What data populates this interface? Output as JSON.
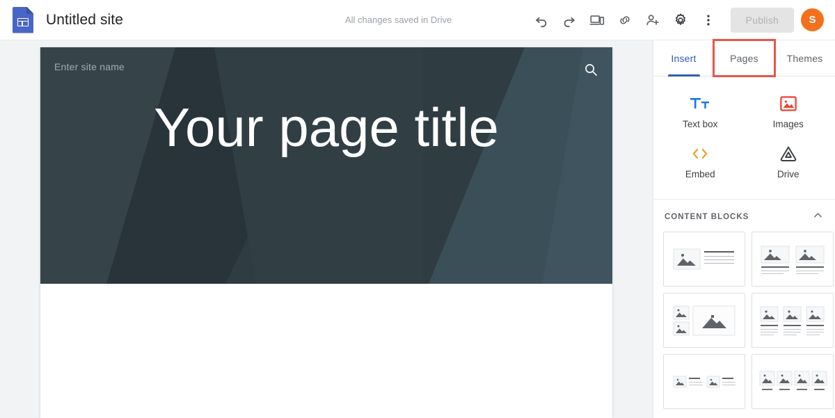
{
  "topbar": {
    "logo_icon": "google-sites-logo",
    "site_title": "Untitled site",
    "save_status": "All changes saved in Drive",
    "actions": [
      {
        "name": "undo",
        "icon": "undo-icon"
      },
      {
        "name": "redo",
        "icon": "redo-icon"
      },
      {
        "name": "preview",
        "icon": "device-preview-icon"
      },
      {
        "name": "copy-link",
        "icon": "link-icon"
      },
      {
        "name": "share",
        "icon": "add-person-icon"
      },
      {
        "name": "settings",
        "icon": "gear-icon"
      },
      {
        "name": "more",
        "icon": "more-vert-icon"
      }
    ],
    "publish_label": "Publish",
    "publish_disabled": true,
    "avatar_initial": "S",
    "avatar_color": "#f4701d"
  },
  "canvas": {
    "site_name_placeholder": "Enter site name",
    "page_title": "Your page title",
    "search_icon": "search-icon",
    "banner_color": "#2f3c42",
    "banner_accent_color": "#3b4f58"
  },
  "panel": {
    "tabs": [
      {
        "label": "Insert",
        "active": true,
        "highlighted": false
      },
      {
        "label": "Pages",
        "active": false,
        "highlighted": true
      },
      {
        "label": "Themes",
        "active": false,
        "highlighted": false
      }
    ],
    "highlight_color": "#e8554a",
    "active_color": "#2f5bb7",
    "insert_items": [
      {
        "label": "Text box",
        "icon": "text-box-icon",
        "color": "#1a73e8"
      },
      {
        "label": "Images",
        "icon": "image-icon",
        "color": "#ea4335"
      },
      {
        "label": "Embed",
        "icon": "embed-code-icon",
        "color": "#f0a020"
      },
      {
        "label": "Drive",
        "icon": "google-drive-icon",
        "color": "#3c4043"
      }
    ],
    "content_blocks": {
      "title": "CONTENT BLOCKS",
      "collapse_icon": "chevron-up-icon",
      "layouts": [
        {
          "name": "image-left-text-right"
        },
        {
          "name": "two-images-with-captions"
        },
        {
          "name": "two-small-images-one-large"
        },
        {
          "name": "three-images-with-captions"
        },
        {
          "name": "two-image-text-pairs"
        },
        {
          "name": "four-images-with-labels"
        }
      ]
    }
  }
}
